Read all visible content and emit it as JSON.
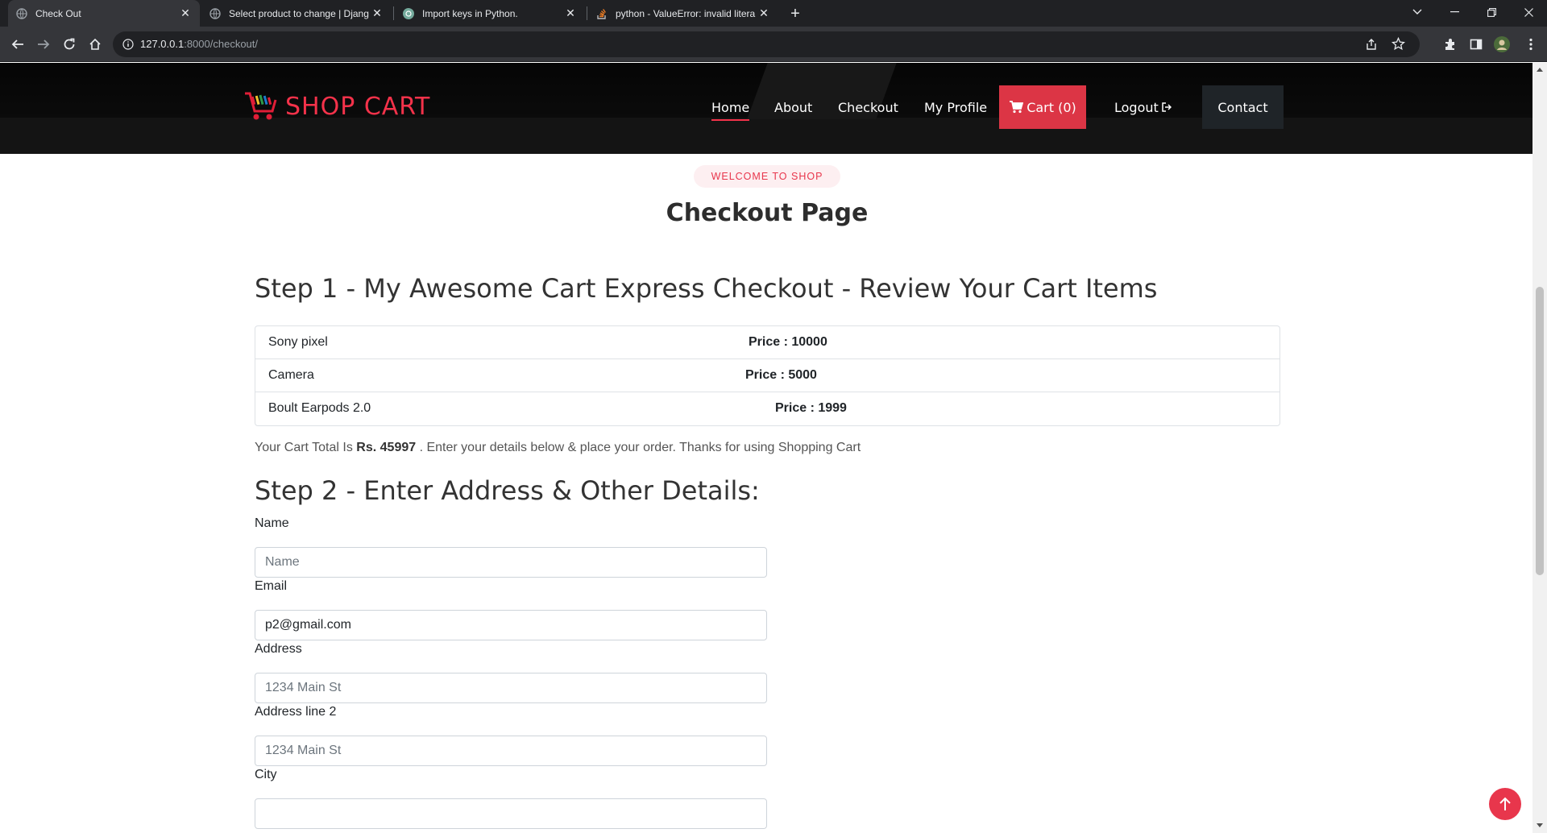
{
  "browser": {
    "tabs": [
      {
        "title": "Check Out",
        "active": true
      },
      {
        "title": "Select product to change | Djang",
        "active": false
      },
      {
        "title": "Import keys in Python.",
        "active": false
      },
      {
        "title": "python - ValueError: invalid litera",
        "active": false
      }
    ],
    "url_host": "127.0.0.1",
    "url_rest": ":8000/checkout/"
  },
  "site": {
    "brand": "SHOP CART",
    "nav": {
      "home": "Home",
      "about": "About",
      "checkout": "Checkout",
      "profile": "My Profile",
      "cart": "Cart (0)",
      "logout": "Logout",
      "contact": "Contact"
    }
  },
  "page": {
    "badge": "WELCOME TO SHOP",
    "heading": "Checkout Page",
    "step1_heading": "Step 1 - My Awesome Cart Express Checkout - Review Your Cart Items",
    "cart_items": [
      {
        "name": "Sony pixel",
        "price": "Price : 10000"
      },
      {
        "name": "Camera",
        "price": "Price : 5000"
      },
      {
        "name": "Boult Earpods 2.0",
        "price": "Price : 1999"
      }
    ],
    "total_prefix": "Your Cart Total Is ",
    "total_value": "Rs. 45997",
    "total_suffix": " . Enter your details below & place your order. Thanks for using Shopping Cart",
    "step2_heading": "Step 2 - Enter Address & Other Details:",
    "form": {
      "name_label": "Name",
      "name_placeholder": "Name",
      "email_label": "Email",
      "email_value": "p2@gmail.com",
      "address_label": "Address",
      "address_placeholder": "1234 Main St",
      "address2_label": "Address line 2",
      "address2_placeholder": "1234 Main St",
      "city_label": "City"
    }
  },
  "colors": {
    "accent": "#e8364c",
    "header_bg": "#141414",
    "cart_button": "#dc3545"
  }
}
